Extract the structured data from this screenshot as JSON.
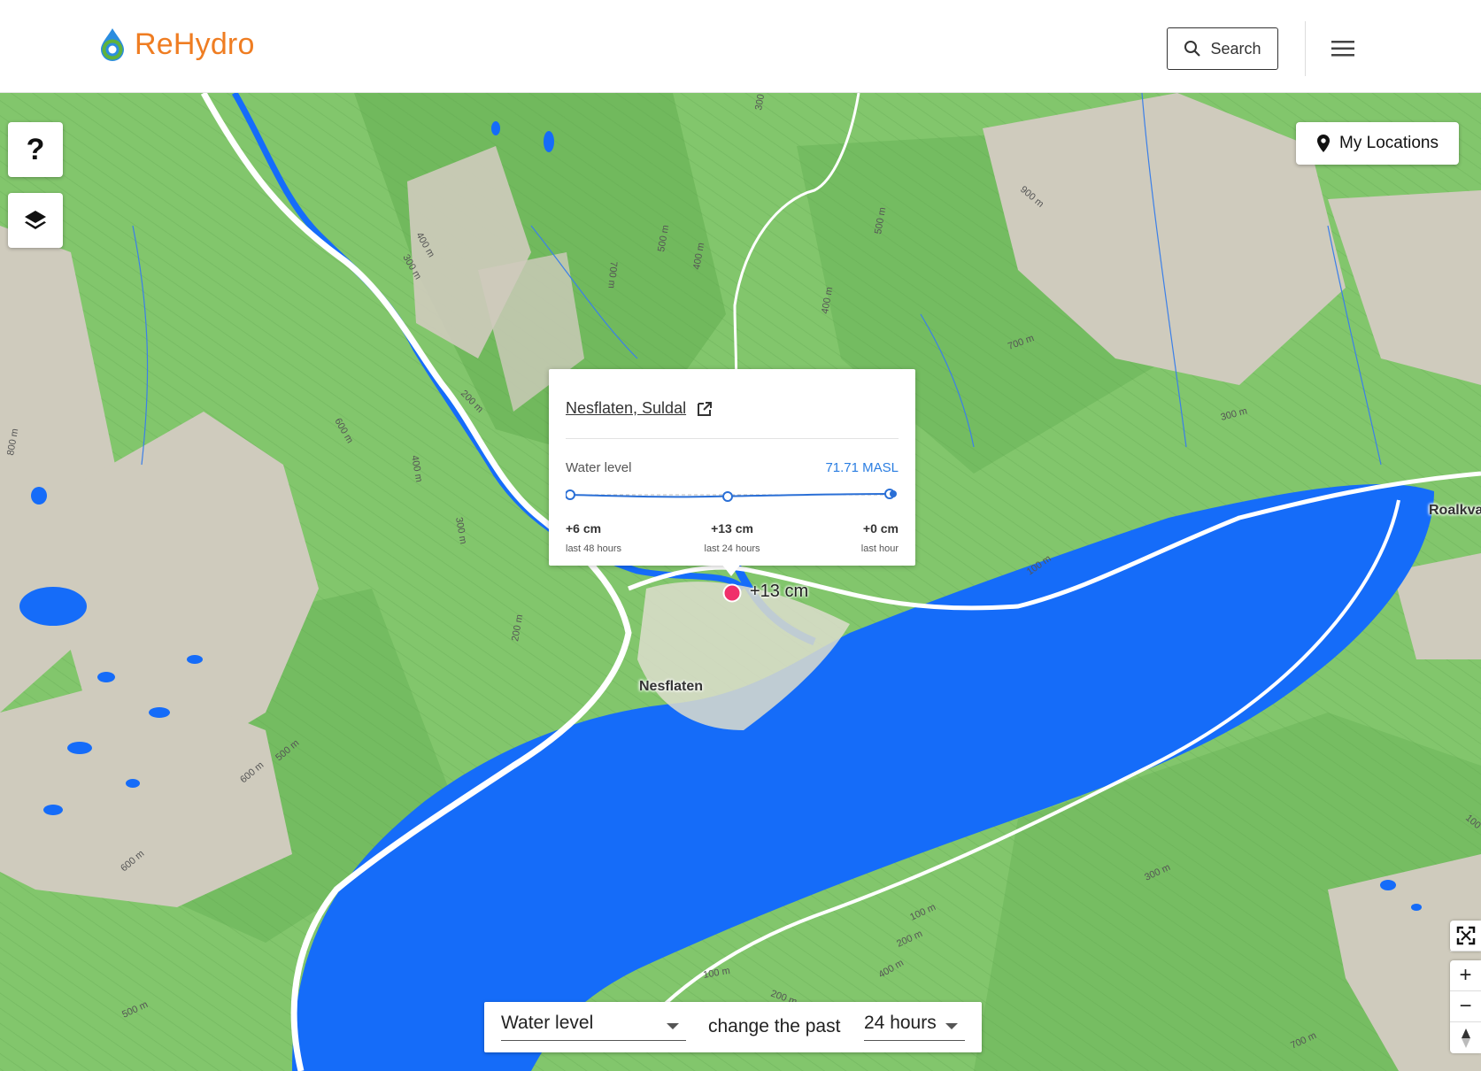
{
  "app": {
    "name": "ReHydro",
    "brand_color": "#ef7d22",
    "accent_color": "#2a7de1"
  },
  "header": {
    "search_label": "Search",
    "search_icon": "search-icon",
    "menu_icon": "hamburger-menu-icon"
  },
  "map": {
    "help_label": "?",
    "layers_icon": "layers-icon",
    "my_locations_label": "My Locations",
    "my_locations_icon": "location-pin-icon",
    "marker_value": "+13 cm",
    "place_labels": [
      "Nesflaten",
      "Roalkva"
    ],
    "contour_labels": [
      "400 m",
      "300 m",
      "700 m",
      "500 m",
      "400 m",
      "500 m",
      "400 m",
      "300 m",
      "200 m",
      "600 m",
      "400 m",
      "300 m",
      "900 m",
      "700 m",
      "300 m",
      "200 m",
      "100 m",
      "600 m",
      "500 m",
      "600 m",
      "500 m",
      "300 m",
      "100 m",
      "200 m",
      "100 m",
      "400 m",
      "200 m",
      "700 m",
      "800 m",
      "100"
    ],
    "colors": {
      "water": "#156cf9",
      "forest": "#7fc46a",
      "rock": "#cfcbbd"
    }
  },
  "popup": {
    "location_name": "Nesflaten, Suldal",
    "external_link_icon": "external-link-icon",
    "metric_label": "Water level",
    "metric_value": "71.71 MASL",
    "stats": [
      {
        "value": "+6 cm",
        "period": "last 48 hours"
      },
      {
        "value": "+13 cm",
        "period": "last 24 hours"
      },
      {
        "value": "+0 cm",
        "period": "last hour"
      }
    ]
  },
  "controls": {
    "metric_select": "Water level",
    "change_text": "change the past",
    "period_select": "24 hours",
    "fullscreen_icon": "fullscreen-icon",
    "zoom_in_label": "+",
    "zoom_out_label": "−",
    "compass_icon": "compass-icon"
  }
}
